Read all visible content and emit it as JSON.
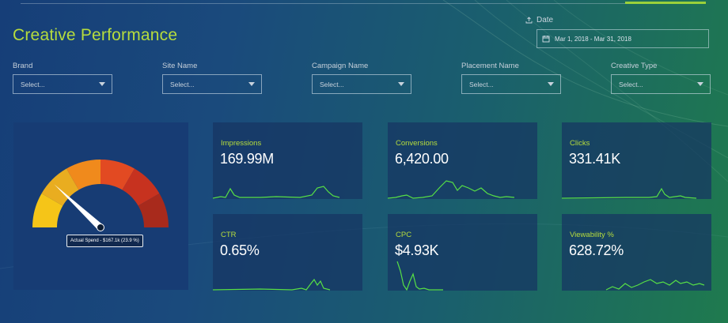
{
  "page": {
    "title": "Creative Performance"
  },
  "date": {
    "label": "Date",
    "range": "Mar 1, 2018 - Mar 31, 2018"
  },
  "filters": [
    {
      "label": "Brand",
      "placeholder": "Select..."
    },
    {
      "label": "Site Name",
      "placeholder": "Select..."
    },
    {
      "label": "Campaign Name",
      "placeholder": "Select..."
    },
    {
      "label": "Placement Name",
      "placeholder": "Select..."
    },
    {
      "label": "Creative Type",
      "placeholder": "Select..."
    }
  ],
  "gauge": {
    "tooltip": "Actual Spend - $167.1k (23.9 %)",
    "value_percent": 23.9,
    "segment_colors": [
      "#f5c518",
      "#e9ad20",
      "#f08a1c",
      "#e24a22",
      "#c7321f",
      "#a82a1c"
    ]
  },
  "metrics": [
    {
      "label": "Impressions",
      "value": "169.99M"
    },
    {
      "label": "Conversions",
      "value": "6,420.00"
    },
    {
      "label": "Clicks",
      "value": "331.41K"
    },
    {
      "label": "CTR",
      "value": "0.65%"
    },
    {
      "label": "CPC",
      "value": "$4.93K"
    },
    {
      "label": "Viewability %",
      "value": "628.72%"
    }
  ],
  "colors": {
    "accent": "#b6dc3d",
    "sparkline": "#57e045",
    "card": "#16345f"
  },
  "icons": {
    "date": "upload-icon",
    "calendar": "calendar-icon",
    "dropdown": "chevron-down-icon"
  }
}
